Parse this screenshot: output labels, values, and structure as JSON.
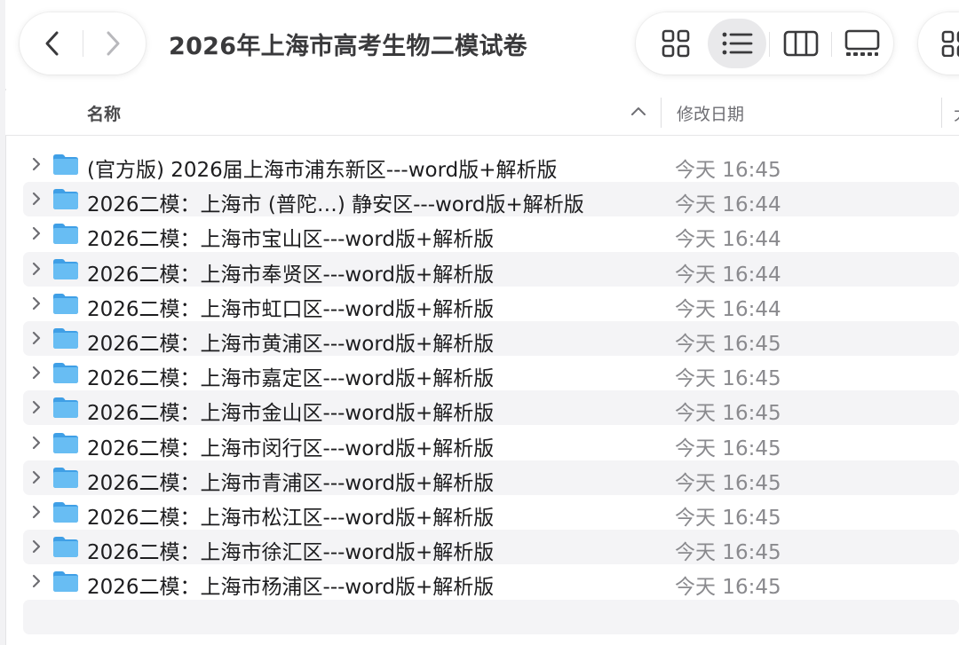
{
  "window": {
    "title": "2026年上海市高考生物二模试卷"
  },
  "toolbar": {
    "back_icon": "chevron-left-icon",
    "forward_icon": "chevron-right-icon",
    "views": [
      {
        "name": "icon-view",
        "icon": "grid-icon",
        "active": false
      },
      {
        "name": "list-view",
        "icon": "list-icon",
        "active": true
      },
      {
        "name": "column-view",
        "icon": "columns-icon",
        "active": false
      },
      {
        "name": "gallery-view",
        "icon": "gallery-icon",
        "active": false
      }
    ],
    "group_icon": "group-icon"
  },
  "columns": {
    "name": "名称",
    "date": "修改日期",
    "next": "大",
    "sort": "ascending"
  },
  "colors": {
    "folder": "#5ab4f0",
    "row_alt": "#f4f4f6",
    "active_view": "#e9e9eb"
  },
  "files": [
    {
      "name": "(官方版) 2026届上海市浦东新区---word版+解析版",
      "date": "今天 16:45"
    },
    {
      "name": "2026二模：上海市 (普陀…) 静安区---word版+解析版",
      "date": "今天 16:44"
    },
    {
      "name": "2026二模：上海市宝山区---word版+解析版",
      "date": "今天 16:44"
    },
    {
      "name": "2026二模：上海市奉贤区---word版+解析版",
      "date": "今天 16:44"
    },
    {
      "name": "2026二模：上海市虹口区---word版+解析版",
      "date": "今天 16:44"
    },
    {
      "name": "2026二模：上海市黄浦区---word版+解析版",
      "date": "今天 16:45"
    },
    {
      "name": "2026二模：上海市嘉定区---word版+解析版",
      "date": "今天 16:45"
    },
    {
      "name": "2026二模：上海市金山区---word版+解析版",
      "date": "今天 16:45"
    },
    {
      "name": "2026二模：上海市闵行区---word版+解析版",
      "date": "今天 16:45"
    },
    {
      "name": "2026二模：上海市青浦区---word版+解析版",
      "date": "今天 16:45"
    },
    {
      "name": "2026二模：上海市松江区---word版+解析版",
      "date": "今天 16:45"
    },
    {
      "name": "2026二模：上海市徐汇区---word版+解析版",
      "date": "今天 16:45"
    },
    {
      "name": "2026二模：上海市杨浦区---word版+解析版",
      "date": "今天 16:45"
    }
  ]
}
